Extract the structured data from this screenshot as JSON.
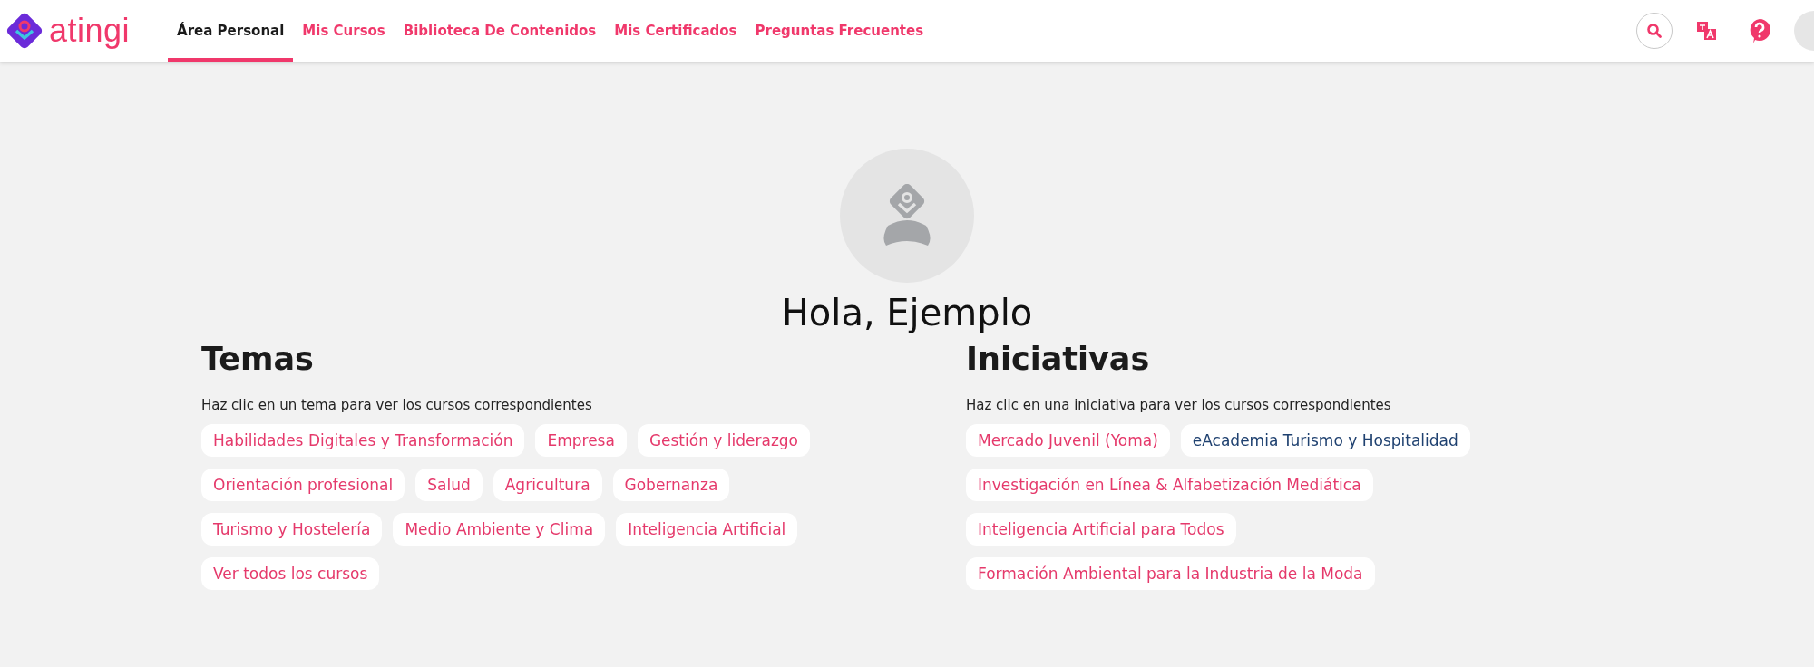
{
  "header": {
    "logo_text": "atingi",
    "nav": [
      {
        "label": "Área Personal",
        "selected": true
      },
      {
        "label": "Mis Cursos",
        "selected": false
      },
      {
        "label": "Biblioteca De Contenidos",
        "selected": false
      },
      {
        "label": "Mis Certificados",
        "selected": false
      },
      {
        "label": "Preguntas Frecuentes",
        "selected": false
      }
    ]
  },
  "greeting": "Hola, Ejemplo",
  "sections": [
    {
      "title": "Temas",
      "hint": "Haz clic en un tema para ver los cursos correspondientes",
      "items": [
        {
          "label": "Habilidades Digitales y Transformación",
          "color": "#e5396b"
        },
        {
          "label": "Empresa",
          "color": "#e5396b"
        },
        {
          "label": "Gestión y liderazgo",
          "color": "#e5396b"
        },
        {
          "label": "Orientación profesional",
          "color": "#e5396b"
        },
        {
          "label": "Salud",
          "color": "#e5396b"
        },
        {
          "label": "Agricultura",
          "color": "#e5396b"
        },
        {
          "label": "Gobernanza",
          "color": "#e5396b"
        },
        {
          "label": "Turismo y Hostelería",
          "color": "#e5396b"
        },
        {
          "label": "Medio Ambiente y Clima",
          "color": "#e5396b"
        },
        {
          "label": "Inteligencia Artificial",
          "color": "#e5396b"
        },
        {
          "label": "Ver todos los cursos",
          "color": "#e5396b"
        }
      ]
    },
    {
      "title": "Iniciativas",
      "hint": "Haz clic en una iniciativa para ver los cursos correspondientes",
      "items": [
        {
          "label": "Mercado Juvenil (Yoma)",
          "color": "#e5396b"
        },
        {
          "label": "eAcademia Turismo y Hospitalidad",
          "color": "#1f4170"
        },
        {
          "label": "Investigación en Línea & Alfabetización Mediática",
          "color": "#e5396b"
        },
        {
          "label": "Inteligencia Artificial para Todos",
          "color": "#e5396b"
        },
        {
          "label": "Formación Ambiental para la Industria de la Moda",
          "color": "#e5396b"
        }
      ]
    }
  ]
}
